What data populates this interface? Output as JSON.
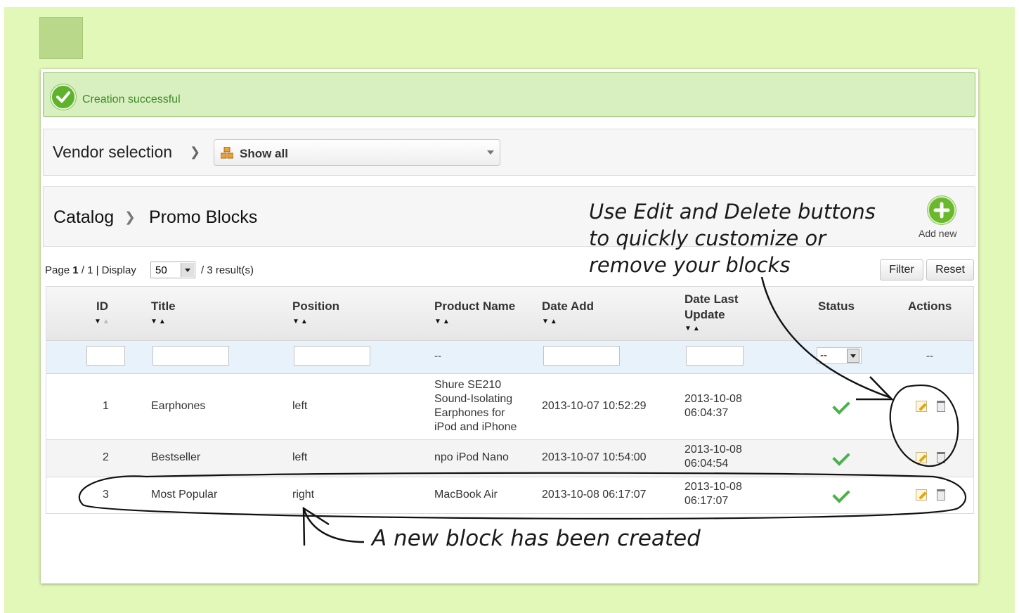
{
  "message": {
    "success_text": "Creation successful",
    "icon": "checkmark-circle-icon"
  },
  "vendor": {
    "label": "Vendor selection",
    "selected": "Show all",
    "icon": "vendor-icon"
  },
  "breadcrumb": {
    "items": [
      "Catalog",
      "Promo Blocks"
    ]
  },
  "toolbar": {
    "add_new_label": "Add new",
    "filter_label": "Filter",
    "reset_label": "Reset"
  },
  "pager": {
    "page_word": "Page",
    "page_current": "1",
    "page_total": "/ 1 | Display",
    "per_page": "50",
    "results": "/ 3 result(s)"
  },
  "table": {
    "headers": [
      "ID",
      "Title",
      "Position",
      "Product Name",
      "Date Add",
      "Date Last Update",
      "Status",
      "Actions"
    ],
    "filter_placeholders": {
      "product_name": "--",
      "status": "--",
      "actions": "--"
    },
    "rows": [
      {
        "id": "1",
        "title": "Earphones",
        "position": "left",
        "product": "Shure SE210 Sound-Isolating Earphones for iPod and iPhone",
        "date_add": "2013-10-07 10:52:29",
        "date_update": "2013-10-08 06:04:37",
        "status": "enabled"
      },
      {
        "id": "2",
        "title": "Bestseller",
        "position": "left",
        "product": "npo iPod Nano",
        "date_add": "2013-10-07 10:54:00",
        "date_update": "2013-10-08 06:04:54",
        "status": "enabled"
      },
      {
        "id": "3",
        "title": "Most Popular",
        "position": "right",
        "product": "MacBook Air",
        "date_add": "2013-10-08 06:17:07",
        "date_update": "2013-10-08 06:17:07",
        "status": "enabled"
      }
    ]
  },
  "annotations": {
    "edit_delete_note": [
      "Use Edit and Delete buttons",
      "to quickly customize or",
      "remove your blocks"
    ],
    "new_block_note": "A new block has been created"
  },
  "colors": {
    "background": "#e2f8b8",
    "success_bg": "#d8f0c0",
    "success_text": "#3f8a2a",
    "accent_green": "#6ab82c",
    "filter_row_bg": "#e8f2fb"
  }
}
